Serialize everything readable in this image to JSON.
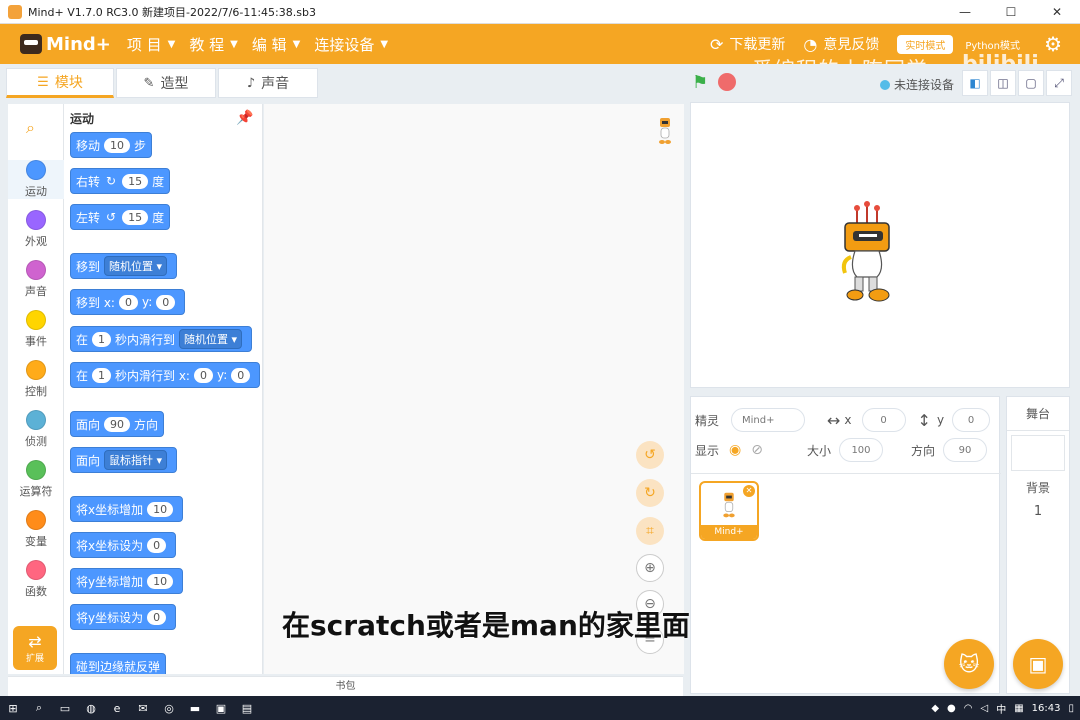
{
  "window": {
    "title": "Mind+ V1.7.0 RC3.0   新建项目-2022/7/6-11:45:38.sb3",
    "minimize": "—",
    "maximize": "☐",
    "close": "✕"
  },
  "menubar": {
    "logo": "Mind+",
    "items": [
      "项 目",
      "教 程",
      "编 辑",
      "连接设备"
    ],
    "download_update": "下载更新",
    "right_partial": "意見反馈",
    "mode_pill": "实时模式",
    "right_extra": "Python模式",
    "watermark": "爱编程的小陈同学",
    "bili": "bilibili"
  },
  "tabs": {
    "blocks": "模块",
    "costumes": "造型",
    "sounds": "声音"
  },
  "stage_controls": {
    "connection": "未连接设备"
  },
  "categories": [
    {
      "label": "运动",
      "color": "#4c97ff"
    },
    {
      "label": "外观",
      "color": "#9966ff"
    },
    {
      "label": "声音",
      "color": "#cf63cf"
    },
    {
      "label": "事件",
      "color": "#ffd500"
    },
    {
      "label": "控制",
      "color": "#ffab19"
    },
    {
      "label": "侦测",
      "color": "#5cb1d6"
    },
    {
      "label": "运算符",
      "color": "#59c059"
    },
    {
      "label": "变量",
      "color": "#ff8c1a"
    },
    {
      "label": "函数",
      "color": "#ff6680"
    }
  ],
  "extension_label": "扩展",
  "palette": {
    "heading": "运动",
    "blocks": {
      "move": {
        "pre": "移动",
        "val": "10",
        "post": "步"
      },
      "turn_right": {
        "pre": "右转",
        "val": "15",
        "post": "度"
      },
      "turn_left": {
        "pre": "左转",
        "val": "15",
        "post": "度"
      },
      "goto": {
        "pre": "移到",
        "drop": "随机位置"
      },
      "goto_xy": {
        "pre": "移到 x:",
        "x": "0",
        "mid": "y:",
        "y": "0"
      },
      "glide": {
        "pre": "在",
        "secs": "1",
        "mid": "秒内滑行到",
        "drop": "随机位置"
      },
      "glide_xy": {
        "pre": "在",
        "secs": "1",
        "mid": "秒内滑行到 x:",
        "x": "0",
        "mid2": "y:",
        "y": "0"
      },
      "point": {
        "pre": "面向",
        "val": "90",
        "post": "方向"
      },
      "point_towards": {
        "pre": "面向",
        "drop": "鼠标指针"
      },
      "change_x": {
        "pre": "将x坐标增加",
        "val": "10"
      },
      "set_x": {
        "pre": "将x坐标设为",
        "val": "0"
      },
      "change_y": {
        "pre": "将y坐标增加",
        "val": "10"
      },
      "set_y": {
        "pre": "将y坐标设为",
        "val": "0"
      },
      "bounce": {
        "pre": "碰到边缘就反弹"
      }
    }
  },
  "subtitle": "在scratch或者是man的家里面的一些",
  "bookbag": "书包",
  "sprite_info": {
    "sprite_label": "精灵",
    "sprite_name": "Mind+",
    "x_label": "x",
    "x_value": "0",
    "y_label": "y",
    "y_value": "0",
    "show_label": "显示",
    "size_label": "大小",
    "size_value": "100",
    "direction_label": "方向",
    "direction_value": "90",
    "card_name": "Mind+"
  },
  "stage_panel": {
    "header": "舞台",
    "backdrop_label": "背景",
    "backdrop_count": "1"
  },
  "taskbar": {
    "ime": "中",
    "time": "16:43"
  }
}
